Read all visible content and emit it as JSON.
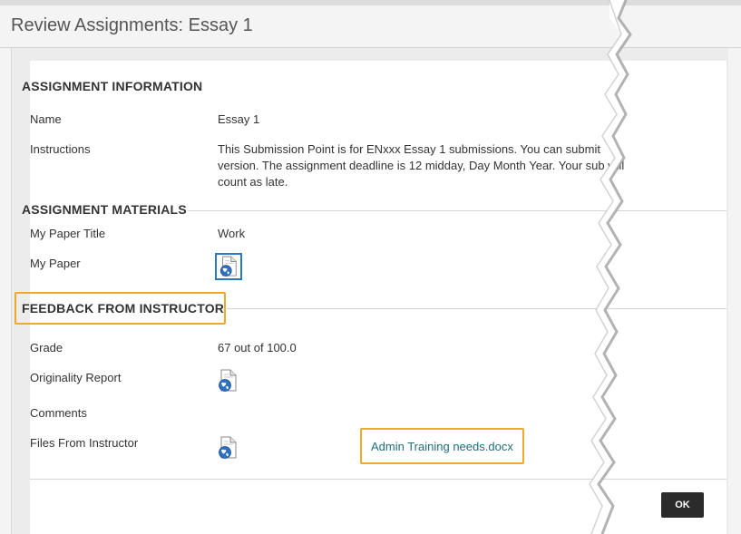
{
  "page": {
    "title": "Review Assignments: Essay 1"
  },
  "assignment_information": {
    "heading": "ASSIGNMENT INFORMATION",
    "name_label": "Name",
    "name_value": "Essay 1",
    "instructions_label": "Instructions",
    "instructions_value": "This Submission Point is for ENxxx Essay 1 submissions. You can submit version. The assignment deadline is 12 midday, Day Month Year. Your sub will count as late."
  },
  "assignment_materials": {
    "heading": "ASSIGNMENT MATERIALS",
    "title_label": "My Paper Title",
    "title_value": "Work",
    "paper_label": "My Paper",
    "paper_icon": "document-globe-icon"
  },
  "feedback": {
    "heading": "FEEDBACK FROM INSTRUCTOR",
    "grade_label": "Grade",
    "grade_value": "67 out of 100.0",
    "originality_label": "Originality Report",
    "originality_icon": "document-globe-icon",
    "comments_label": "Comments",
    "files_label": "Files From Instructor",
    "files_icon": "document-globe-icon",
    "file_link": "Admin Training needs.docx"
  },
  "actions": {
    "ok_label": "OK"
  },
  "colors": {
    "highlight": "#f0a92a",
    "link": "#1f6e7a",
    "button": "#2b2b2b",
    "focus": "#2a78c2"
  }
}
